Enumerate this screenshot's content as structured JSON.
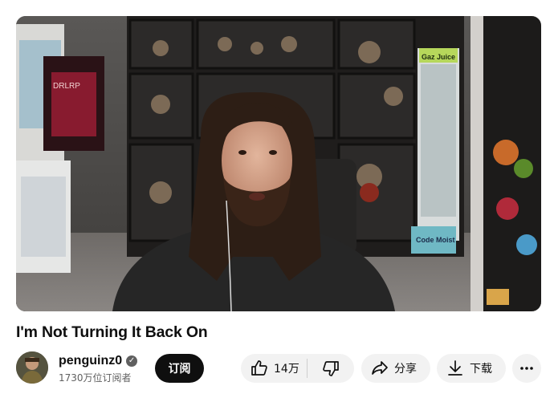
{
  "video": {
    "title": "I'm Not Turning It Back On",
    "thumbnail_signs": {
      "left": "DRLRP",
      "juice": "Gaz Juice",
      "code": "Code Moist"
    }
  },
  "channel": {
    "name": "penguinz0",
    "verified": true,
    "subscribers": "1730万位订阅者",
    "subscribe_label": "订阅"
  },
  "actions": {
    "like_count": "14万",
    "share_label": "分享",
    "download_label": "下载"
  },
  "icons": {
    "like": "thumbs-up-icon",
    "dislike": "thumbs-down-icon",
    "share": "share-arrow-icon",
    "download": "download-icon",
    "more": "more-horizontal-icon",
    "verified": "verified-check-icon"
  },
  "colors": {
    "subscribe_bg": "#0f0f0f",
    "pill_bg": "#f2f2f2",
    "secondary_text": "#606060"
  }
}
